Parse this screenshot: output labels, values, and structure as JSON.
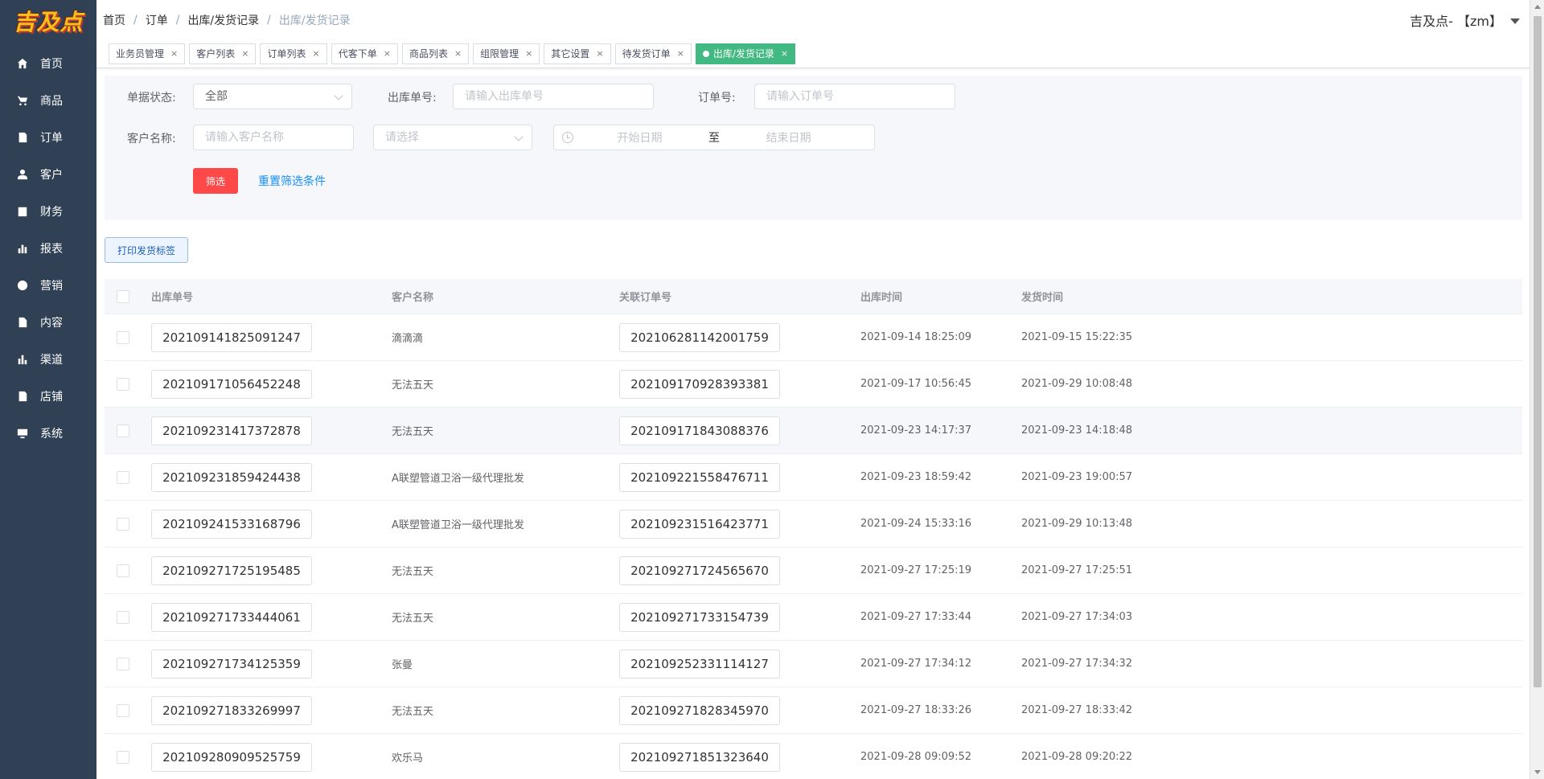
{
  "logo": {
    "text": "吉及点"
  },
  "sidebar": {
    "items": [
      {
        "label": "首页",
        "icon": "home-icon"
      },
      {
        "label": "商品",
        "icon": "cart-icon"
      },
      {
        "label": "订单",
        "icon": "order-icon"
      },
      {
        "label": "客户",
        "icon": "user-icon"
      },
      {
        "label": "财务",
        "icon": "finance-icon"
      },
      {
        "label": "报表",
        "icon": "chart-icon"
      },
      {
        "label": "营销",
        "icon": "percent-icon"
      },
      {
        "label": "内容",
        "icon": "document-icon"
      },
      {
        "label": "渠道",
        "icon": "bar-chart-icon"
      },
      {
        "label": "店铺",
        "icon": "store-icon"
      },
      {
        "label": "系统",
        "icon": "monitor-icon"
      }
    ]
  },
  "breadcrumb": {
    "items": [
      "首页",
      "订单",
      "出库/发货记录"
    ],
    "current": "出库/发货记录",
    "sep": "/"
  },
  "user": {
    "name": "吉及点- 【zm】"
  },
  "tags": [
    {
      "label": "业务员管理"
    },
    {
      "label": "客户列表"
    },
    {
      "label": "订单列表"
    },
    {
      "label": "代客下单"
    },
    {
      "label": "商品列表"
    },
    {
      "label": "组限管理"
    },
    {
      "label": "其它设置"
    },
    {
      "label": "待发货订单"
    },
    {
      "label": "出库/发货记录",
      "active": true
    }
  ],
  "tag_close": "×",
  "filter": {
    "status_label": "单据状态:",
    "status_value": "全部",
    "outbound_label": "出库单号:",
    "outbound_placeholder": "请输入出库单号",
    "order_label": "订单号:",
    "order_placeholder": "请输入订单号",
    "customer_label": "客户名称:",
    "customer_placeholder": "请输入客户名称",
    "select_placeholder": "请选择",
    "start_placeholder": "开始日期",
    "range_sep": "至",
    "end_placeholder": "结束日期",
    "filter_button": "筛选",
    "reset_link": "重置筛选条件"
  },
  "print_button": "打印发货标签",
  "table": {
    "headers": [
      "出库单号",
      "客户名称",
      "关联订单号",
      "出库时间",
      "发货时间"
    ],
    "rows": [
      {
        "outbound_no": "202109141825091247",
        "customer": "滴滴滴",
        "order_no": "202106281142001759",
        "out_time": "2021-09-14 18:25:09",
        "ship_time": "2021-09-15 15:22:35"
      },
      {
        "outbound_no": "202109171056452248",
        "customer": "无法五天",
        "order_no": "202109170928393381",
        "out_time": "2021-09-17 10:56:45",
        "ship_time": "2021-09-29 10:08:48"
      },
      {
        "outbound_no": "202109231417372878",
        "customer": "无法五天",
        "order_no": "202109171843088376",
        "out_time": "2021-09-23 14:17:37",
        "ship_time": "2021-09-23 14:18:48"
      },
      {
        "outbound_no": "202109231859424438",
        "customer": "A联塑管道卫浴一级代理批发",
        "order_no": "202109221558476711",
        "out_time": "2021-09-23 18:59:42",
        "ship_time": "2021-09-23 19:00:57"
      },
      {
        "outbound_no": "202109241533168796",
        "customer": "A联塑管道卫浴一级代理批发",
        "order_no": "202109231516423771",
        "out_time": "2021-09-24 15:33:16",
        "ship_time": "2021-09-29 10:13:48"
      },
      {
        "outbound_no": "202109271725195485",
        "customer": "无法五天",
        "order_no": "202109271724565670",
        "out_time": "2021-09-27 17:25:19",
        "ship_time": "2021-09-27 17:25:51"
      },
      {
        "outbound_no": "202109271733444061",
        "customer": "无法五天",
        "order_no": "202109271733154739",
        "out_time": "2021-09-27 17:33:44",
        "ship_time": "2021-09-27 17:34:03"
      },
      {
        "outbound_no": "202109271734125359",
        "customer": "张曼",
        "order_no": "202109252331114127",
        "out_time": "2021-09-27 17:34:12",
        "ship_time": "2021-09-27 17:34:32"
      },
      {
        "outbound_no": "202109271833269997",
        "customer": "无法五天",
        "order_no": "202109271828345970",
        "out_time": "2021-09-27 18:33:26",
        "ship_time": "2021-09-27 18:33:42"
      },
      {
        "outbound_no": "202109280909525759",
        "customer": "欢乐马",
        "order_no": "202109271851323640",
        "out_time": "2021-09-28 09:09:52",
        "ship_time": "2021-09-28 09:20:22"
      }
    ],
    "highlighted_row": 2
  }
}
